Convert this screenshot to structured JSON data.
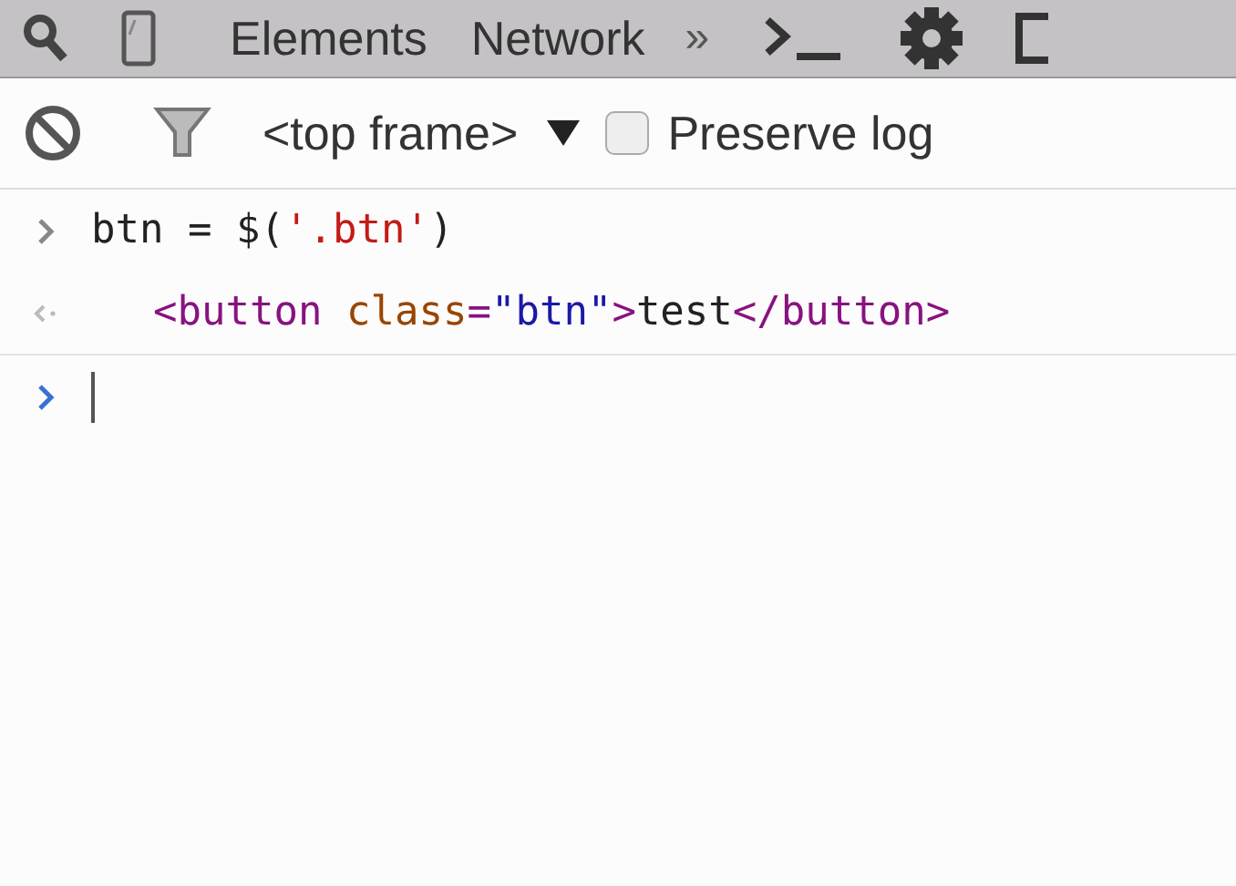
{
  "tabs": [
    {
      "label": "Elements",
      "selected": false
    },
    {
      "label": "Network",
      "selected": false
    }
  ],
  "more_tabs": "»",
  "toolbar": {
    "context": "<top frame>",
    "preserve_log": {
      "label": "Preserve log",
      "checked": false
    }
  },
  "console": [
    {
      "kind": "input",
      "tokens": [
        {
          "text": "btn = $(",
          "kind": "plain"
        },
        {
          "text": "'.btn'",
          "kind": "string"
        },
        {
          "text": ")",
          "kind": "plain"
        }
      ]
    },
    {
      "kind": "result",
      "tokens": [
        {
          "text": "<button",
          "kind": "tag"
        },
        {
          "text": " class",
          "kind": "attr"
        },
        {
          "text": "=",
          "kind": "tag"
        },
        {
          "text": "\"btn\"",
          "kind": "value"
        },
        {
          "text": ">",
          "kind": "tag"
        },
        {
          "text": "test",
          "kind": "plain"
        },
        {
          "text": "</button>",
          "kind": "tag"
        }
      ]
    }
  ]
}
